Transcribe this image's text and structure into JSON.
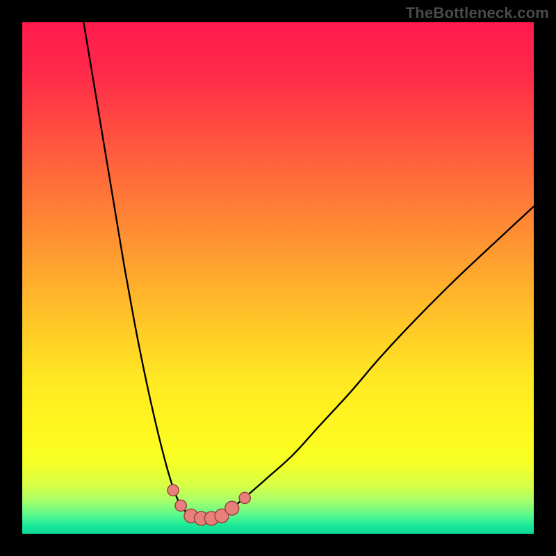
{
  "watermark": "TheBottleneck.com",
  "colors": {
    "frame": "#000000",
    "gradient_stops": [
      {
        "pos": 0.0,
        "color": "#ff1a4d"
      },
      {
        "pos": 0.1,
        "color": "#ff2a49"
      },
      {
        "pos": 0.25,
        "color": "#ff5a3e"
      },
      {
        "pos": 0.4,
        "color": "#ff8a34"
      },
      {
        "pos": 0.55,
        "color": "#ffbb2a"
      },
      {
        "pos": 0.7,
        "color": "#ffe922"
      },
      {
        "pos": 0.8,
        "color": "#fff820"
      },
      {
        "pos": 0.86,
        "color": "#f6ff24"
      },
      {
        "pos": 0.905,
        "color": "#d8ff46"
      },
      {
        "pos": 0.935,
        "color": "#a8ff6a"
      },
      {
        "pos": 0.965,
        "color": "#56f88e"
      },
      {
        "pos": 0.985,
        "color": "#17e89a"
      },
      {
        "pos": 1.0,
        "color": "#0fd895"
      }
    ],
    "curve_stroke": "#000000",
    "marker_fill": "#e77f7b",
    "marker_stroke": "#9a3e3b"
  },
  "chart_data": {
    "type": "line",
    "title": "",
    "xlabel": "",
    "ylabel": "",
    "xlim": [
      0,
      100
    ],
    "ylim": [
      0,
      100
    ],
    "grid": false,
    "legend_position": "none",
    "description": "V-shaped absolute-deviation curve on a vertical red→green heat gradient; minimum band highlighted with pink markers near x≈33–40.",
    "series": [
      {
        "name": "left-branch",
        "x": [
          12,
          14,
          16,
          18,
          20,
          22,
          24,
          26,
          28,
          29.5,
          31
        ],
        "y": [
          100,
          88,
          76,
          64,
          52,
          41,
          31,
          22,
          14,
          9,
          5.5
        ]
      },
      {
        "name": "valley",
        "x": [
          31,
          33,
          35,
          37,
          39,
          41
        ],
        "y": [
          5.5,
          3.5,
          3.0,
          3.0,
          3.5,
          5.0
        ]
      },
      {
        "name": "right-branch",
        "x": [
          41,
          44,
          48,
          53,
          58,
          64,
          70,
          77,
          85,
          93,
          100
        ],
        "y": [
          5.0,
          7.5,
          11,
          15.5,
          21,
          27.5,
          34.5,
          42,
          50,
          57.5,
          64
        ]
      }
    ],
    "markers": {
      "name": "optimal-range",
      "x": [
        29.5,
        31,
        33,
        35,
        37,
        39,
        41,
        43.5
      ],
      "y": [
        8.5,
        5.5,
        3.5,
        3.0,
        3.0,
        3.5,
        5.0,
        7.0
      ],
      "r": [
        1.1,
        1.1,
        1.35,
        1.35,
        1.35,
        1.35,
        1.35,
        1.1
      ]
    }
  }
}
